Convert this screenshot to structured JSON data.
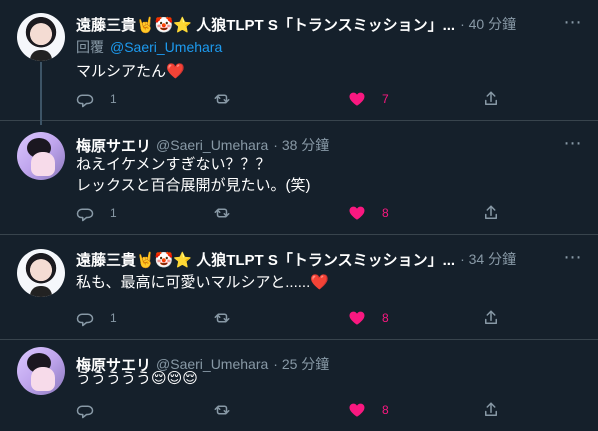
{
  "tweets": [
    {
      "name": "遠藤三貴🤘🤡⭐ 人狼TLPT S「トランスミッション」...",
      "handle": "",
      "time": "40 分鐘",
      "reply_prefix": "回覆",
      "reply_mention": "@Saeri_Umehara",
      "text": "マルシアたん❤️",
      "replies": "1",
      "retweets": "",
      "likes": "7"
    },
    {
      "name": "梅原サエリ",
      "handle": "@Saeri_Umehara",
      "time": "38 分鐘",
      "text": "ねえイケメンすぎない？？？\nレックスと百合展開が見たい。(笑)",
      "replies": "1",
      "retweets": "",
      "likes": "8"
    },
    {
      "name": "遠藤三貴🤘🤡⭐ 人狼TLPT S「トランスミッション」...",
      "handle": "",
      "time": "34 分鐘",
      "text": "私も、最高に可愛いマルシアと......❤️",
      "replies": "1",
      "retweets": "",
      "likes": "8"
    },
    {
      "name": "梅原サエリ",
      "handle": "@Saeri_Umehara",
      "time": "25 分鐘",
      "text": "ううううう😌😌😌",
      "replies": "",
      "retweets": "",
      "likes": "8"
    }
  ],
  "icons": {
    "reply": "reply-icon",
    "retweet": "retweet-icon",
    "like": "heart-icon",
    "share": "share-icon",
    "more": "more-icon"
  },
  "colors": {
    "background": "#15202b",
    "muted": "#8899a6",
    "link": "#1d9bf0",
    "like": "#f91880"
  }
}
